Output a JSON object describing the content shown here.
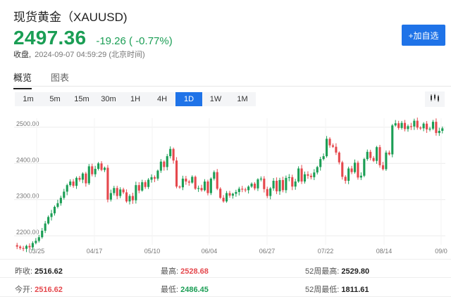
{
  "header": {
    "title": "现货黄金（XAUUSD)",
    "price": "2497.36",
    "change": "-19.26 ( -0.77%)",
    "closed_label": "收盘,",
    "timestamp": "2024-09-07 04:59:29 (北京时间)",
    "add_button": "+加自选"
  },
  "tabs": [
    {
      "label": "概览",
      "active": true
    },
    {
      "label": "图表",
      "active": false
    }
  ],
  "ranges": [
    {
      "label": "1m",
      "active": false
    },
    {
      "label": "5m",
      "active": false
    },
    {
      "label": "15m",
      "active": false
    },
    {
      "label": "30m",
      "active": false
    },
    {
      "label": "1H",
      "active": false
    },
    {
      "label": "4H",
      "active": false
    },
    {
      "label": "1D",
      "active": true
    },
    {
      "label": "1W",
      "active": false
    },
    {
      "label": "1M",
      "active": false
    }
  ],
  "chart_type_icon": "candlestick-icon",
  "colors": {
    "accent": "#1f73e8",
    "up": "#1b9e55",
    "down": "#e5484d"
  },
  "stats": {
    "prev_close_label": "昨收:",
    "prev_close": "2516.62",
    "open_label": "今开:",
    "open": "2516.62",
    "high_label": "最高:",
    "high": "2528.68",
    "low_label": "最低:",
    "low": "2486.45",
    "week52_high_label": "52周最高:",
    "week52_high": "2529.80",
    "week52_low_label": "52周最低:",
    "week52_low": "1811.61"
  },
  "chart_data": {
    "type": "candlestick",
    "x_tick_labels": [
      "03/25",
      "04/17",
      "05/10",
      "06/04",
      "06/27",
      "07/22",
      "08/14",
      "09/0"
    ],
    "y_tick_labels": [
      "2200.00",
      "2300.00",
      "2400.00",
      "2500.00"
    ],
    "y_ticks": [
      2200,
      2300,
      2400,
      2500
    ],
    "ylim": [
      2175,
      2525
    ],
    "grid": true,
    "closes": [
      2170,
      2166,
      2164,
      2172,
      2168,
      2180,
      2186,
      2196,
      2214,
      2234,
      2252,
      2262,
      2280,
      2290,
      2305,
      2322,
      2340,
      2350,
      2338,
      2360,
      2355,
      2372,
      2345,
      2392,
      2370,
      2385,
      2400,
      2382,
      2388,
      2300,
      2318,
      2332,
      2310,
      2328,
      2320,
      2295,
      2310,
      2298,
      2340,
      2325,
      2348,
      2335,
      2355,
      2362,
      2358,
      2380,
      2405,
      2390,
      2420,
      2440,
      2408,
      2336,
      2334,
      2358,
      2350,
      2347,
      2363,
      2330,
      2332,
      2326,
      2350,
      2318,
      2358,
      2376,
      2330,
      2305,
      2295,
      2318,
      2311,
      2316,
      2321,
      2330,
      2328,
      2326,
      2336,
      2344,
      2331,
      2356,
      2358,
      2329,
      2310,
      2331,
      2352,
      2323,
      2354,
      2326,
      2360,
      2362,
      2336,
      2350,
      2386,
      2350,
      2370,
      2366,
      2362,
      2375,
      2390,
      2412,
      2420,
      2468,
      2450,
      2446,
      2430,
      2403,
      2363,
      2352,
      2386,
      2376,
      2402,
      2361,
      2366,
      2412,
      2432,
      2415,
      2407,
      2445,
      2395,
      2384,
      2430,
      2425,
      2505,
      2511,
      2498,
      2512,
      2495,
      2503,
      2502,
      2518,
      2499,
      2497,
      2510,
      2494,
      2496,
      2515,
      2484,
      2490,
      2497
    ]
  }
}
